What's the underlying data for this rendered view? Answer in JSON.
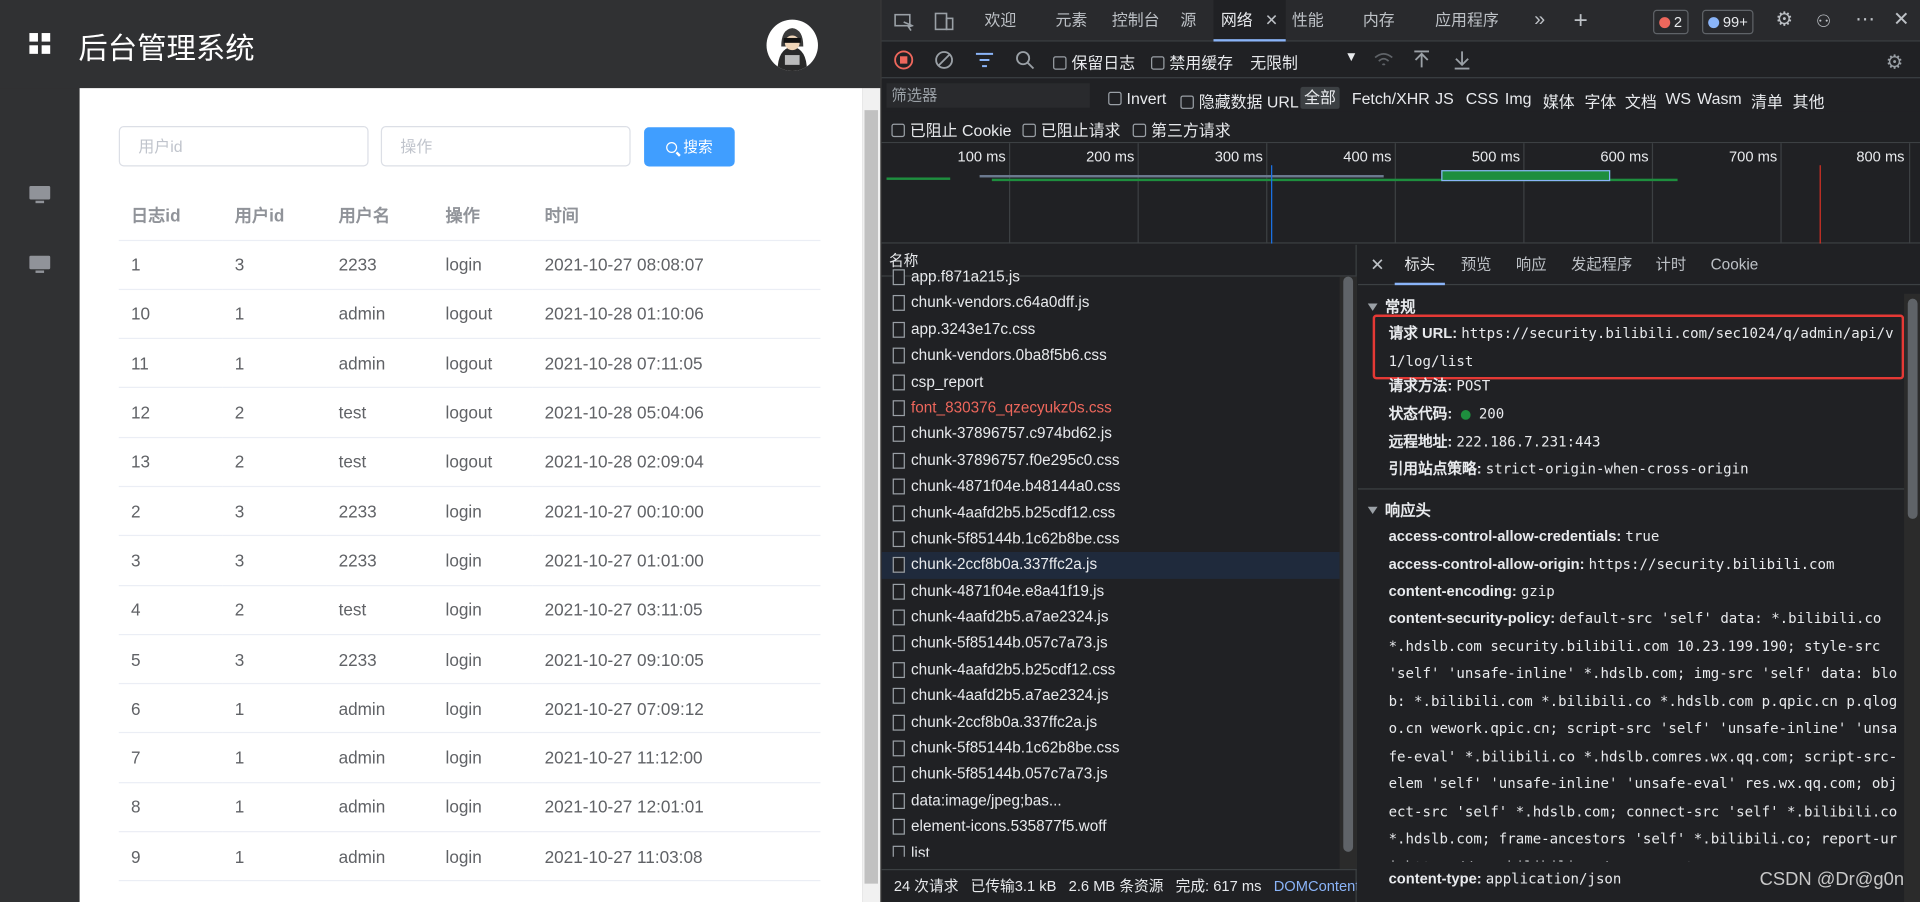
{
  "app": {
    "title": "后台管理系统",
    "search": {
      "uid_placeholder": "用户id",
      "op_placeholder": "操作",
      "button": "搜索"
    },
    "table": {
      "headers": [
        "日志id",
        "用户id",
        "用户名",
        "操作",
        "时间"
      ],
      "rows": [
        [
          "1",
          "3",
          "2233",
          "login",
          "2021-10-27 08:08:07"
        ],
        [
          "10",
          "1",
          "admin",
          "logout",
          "2021-10-28 01:10:06"
        ],
        [
          "11",
          "1",
          "admin",
          "logout",
          "2021-10-28 07:11:05"
        ],
        [
          "12",
          "2",
          "test",
          "logout",
          "2021-10-28 05:04:06"
        ],
        [
          "13",
          "2",
          "test",
          "logout",
          "2021-10-28 02:09:04"
        ],
        [
          "2",
          "3",
          "2233",
          "login",
          "2021-10-27 00:10:00"
        ],
        [
          "3",
          "3",
          "2233",
          "login",
          "2021-10-27 01:01:00"
        ],
        [
          "4",
          "2",
          "test",
          "login",
          "2021-10-27 03:11:05"
        ],
        [
          "5",
          "3",
          "2233",
          "login",
          "2021-10-27 09:10:05"
        ],
        [
          "6",
          "1",
          "admin",
          "login",
          "2021-10-27 07:09:12"
        ],
        [
          "7",
          "1",
          "admin",
          "login",
          "2021-10-27 11:12:00"
        ],
        [
          "8",
          "1",
          "admin",
          "login",
          "2021-10-27 12:01:01"
        ],
        [
          "9",
          "1",
          "admin",
          "login",
          "2021-10-27 11:03:08"
        ]
      ]
    }
  },
  "devtools": {
    "tabs": [
      "欢迎",
      "元素",
      "控制台",
      "源",
      "网络",
      "性能",
      "内存",
      "应用程序"
    ],
    "active_tab": "网络",
    "error_count": "2",
    "message_count": "99+",
    "toolbar": {
      "preserve_log": "保留日志",
      "disable_cache": "禁用缓存",
      "throttle": "无限制"
    },
    "filter": {
      "placeholder": "筛选器",
      "invert": "Invert",
      "hide_data_url": "隐藏数据 URL",
      "types": [
        "全部",
        "Fetch/XHR",
        "JS",
        "CSS",
        "Img",
        "媒体",
        "字体",
        "文档",
        "WS",
        "Wasm",
        "清单",
        "其他"
      ],
      "blocked_cookies": "已阻止 Cookie",
      "blocked_requests": "已阻止请求",
      "third_party": "第三方请求"
    },
    "timeline_ticks": [
      "100 ms",
      "200 ms",
      "300 ms",
      "400 ms",
      "500 ms",
      "600 ms",
      "700 ms",
      "800 ms"
    ],
    "names_header": "名称",
    "requests": [
      "app.f871a215.js",
      "chunk-vendors.c64a0dff.js",
      "app.3243e17c.css",
      "chunk-vendors.0ba8f5b6.css",
      "csp_report",
      "font_830376_qzecyukz0s.css",
      "chunk-37896757.c974bd62.js",
      "chunk-37896757.f0e295c0.css",
      "chunk-4871f04e.b48144a0.css",
      "chunk-4aafd2b5.b25cdf12.css",
      "chunk-5f85144b.1c62b8be.css",
      "chunk-2ccf8b0a.337ffc2a.js",
      "chunk-4871f04e.e8a41f19.js",
      "chunk-4aafd2b5.a7ae2324.js",
      "chunk-5f85144b.057c7a73.js",
      "chunk-4aafd2b5.b25cdf12.css",
      "chunk-4aafd2b5.a7ae2324.js",
      "chunk-2ccf8b0a.337ffc2a.js",
      "chunk-5f85144b.1c62b8be.css",
      "chunk-5f85144b.057c7a73.js",
      "data:image/jpeg;bas...",
      "element-icons.535877f5.woff",
      "list"
    ],
    "status": {
      "requests": "24 次请求",
      "transferred": "已传输3.1 kB",
      "resources": "2.6 MB 条资源",
      "finish": "完成: 617 ms",
      "dom": "DOMContent"
    },
    "detail_tabs": [
      "标头",
      "预览",
      "响应",
      "发起程序",
      "计时",
      "Cookie"
    ],
    "general": {
      "title": "常规",
      "url_label": "请求 URL:",
      "url_value": "https://security.bilibili.com/sec1024/q/admin/api/v1/log/list",
      "method_label": "请求方法:",
      "method_value": "POST",
      "status_label": "状态代码:",
      "status_value": "200",
      "remote_label": "远程地址:",
      "remote_value": "222.186.7.231:443",
      "referrer_label": "引用站点策略:",
      "referrer_value": "strict-origin-when-cross-origin"
    },
    "response_headers": {
      "title": "响应头",
      "acac_label": "access-control-allow-credentials:",
      "acac_value": "true",
      "acao_label": "access-control-allow-origin:",
      "acao_value": "https://security.bilibili.com",
      "ce_label": "content-encoding:",
      "ce_value": "gzip",
      "csp_label": "content-security-policy:",
      "csp_value": "default-src 'self' data: *.bilibili.co *.hdslb.com security.bilibili.com 10.23.199.190; style-src 'self' 'unsafe-inline' *.hdslb.com; img-src 'self' data: blob: *.bilibili.com *.bilibili.co *.hdslb.com p.qpic.cn p.qlogo.cn wework.qpic.cn; script-src 'self' 'unsafe-inline' 'unsafe-eval' *.bilibili.co *.hdslb.comres.wx.qq.com; script-src-elem 'self' 'unsafe-inline' 'unsafe-eval' res.wx.qq.com; object-src 'self' *.hdslb.com; connect-src 'self' *.bilibili.co *.hdslb.com; frame-ancestors 'self' *.bilibili.co; report-uri https://src.bilibili.co/csp_report",
      "ct_label": "content-type:",
      "ct_value": "application/json"
    },
    "watermark": "CSDN @Dr@g0n",
    "colors": {
      "accent": "#409eff",
      "highlight_box": "#e53935",
      "active_tab_underline": "#8ab4f8"
    }
  }
}
